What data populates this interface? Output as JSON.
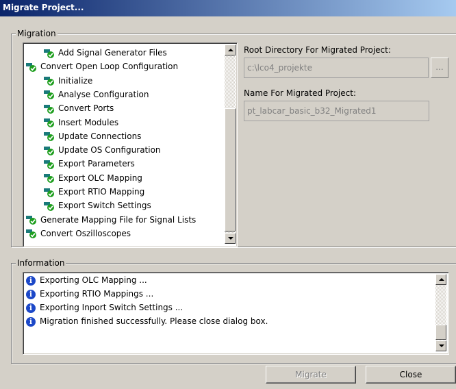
{
  "window": {
    "title": "Migrate Project..."
  },
  "migration_group": {
    "label": "Migration"
  },
  "tree": {
    "items": [
      {
        "label": "Add Signal Generator Files",
        "level": 1
      },
      {
        "label": "Convert Open Loop Configuration",
        "level": 0
      },
      {
        "label": "Initialize",
        "level": 1
      },
      {
        "label": "Analyse Configuration",
        "level": 1
      },
      {
        "label": "Convert Ports",
        "level": 1
      },
      {
        "label": "Insert Modules",
        "level": 1
      },
      {
        "label": "Update Connections",
        "level": 1
      },
      {
        "label": "Update OS Configuration",
        "level": 1
      },
      {
        "label": "Export Parameters",
        "level": 1
      },
      {
        "label": "Export OLC Mapping",
        "level": 1
      },
      {
        "label": "Export RTIO Mapping",
        "level": 1
      },
      {
        "label": "Export Switch Settings",
        "level": 1
      },
      {
        "label": "Generate Mapping File for Signal Lists",
        "level": 0
      },
      {
        "label": "Convert Oszilloscopes",
        "level": 0
      }
    ]
  },
  "root_dir": {
    "label": "Root Directory For Migrated Project:",
    "value": "c:\\lco4_projekte",
    "browse_label": "..."
  },
  "project_name": {
    "label": "Name For Migrated Project:",
    "value": "pt_labcar_basic_b32_Migrated1"
  },
  "information_group": {
    "label": "Information"
  },
  "info": {
    "messages": [
      "Exporting OLC Mapping ...",
      "Exporting RTIO Mappings ...",
      "Exporting Inport Switch Settings ...",
      "Migration finished successfully. Please close dialog box."
    ]
  },
  "buttons": {
    "migrate": "Migrate",
    "close": "Close"
  },
  "colors": {
    "titlebar_start": "#0a246a",
    "titlebar_end": "#a6caf0",
    "check_green": "#1e9e1e",
    "icon_teal": "#1a7a7a"
  }
}
